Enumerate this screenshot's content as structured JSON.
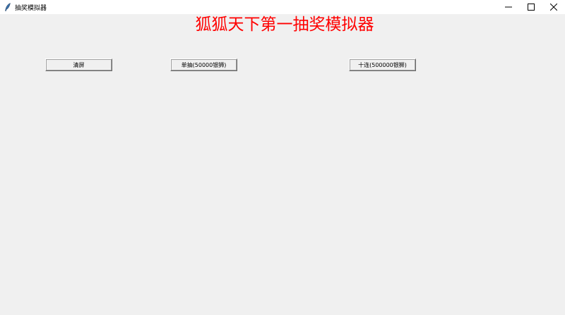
{
  "window": {
    "title": "抽奖模拟器",
    "icon": "feather-icon",
    "controls": {
      "minimize": "—",
      "maximize": "☐",
      "close": "✕"
    }
  },
  "main": {
    "heading": "狐狐天下第一抽奖模拟器",
    "heading_color": "#ff0000",
    "buttons": {
      "clear": "清屏",
      "single": "单抽(50000银狮)",
      "ten": "十连(500000银狮)"
    }
  }
}
